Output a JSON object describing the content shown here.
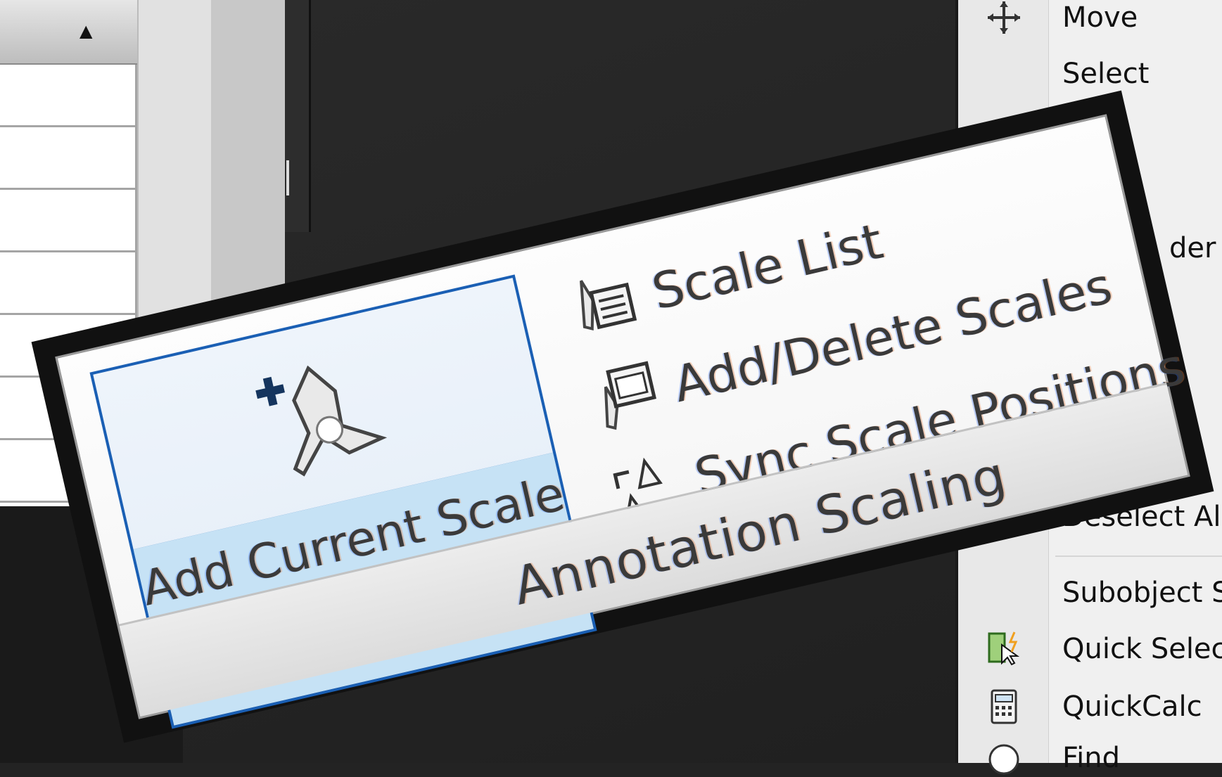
{
  "panel": {
    "title": "Annotation Scaling",
    "add_current_scale": "Add Current Scale",
    "buttons": [
      {
        "label": "Scale List",
        "icon": "scale-list-icon"
      },
      {
        "label": "Add/Delete Scales",
        "icon": "add-delete-scales-icon"
      },
      {
        "label": "Sync Scale Positions",
        "icon": "sync-scale-positions-icon"
      }
    ],
    "accent_color": "#1a5fb4",
    "highlight_color": "#c6e2f5"
  },
  "context_menu": {
    "items": [
      {
        "label": "Move",
        "icon": "move-icon"
      },
      {
        "label": "Select",
        "icon": ""
      },
      {
        "label": "der",
        "icon": ""
      },
      {
        "label": "Deselect All",
        "icon": ""
      },
      {
        "label": "Subobject S",
        "icon": ""
      },
      {
        "label": "Quick Select",
        "icon": "quick-select-icon"
      },
      {
        "label": "QuickCalc",
        "icon": "calculator-icon"
      },
      {
        "label": "Find",
        "icon": "find-icon"
      }
    ]
  },
  "left_table": {
    "sort_icon": "sort-ascending-icon"
  }
}
